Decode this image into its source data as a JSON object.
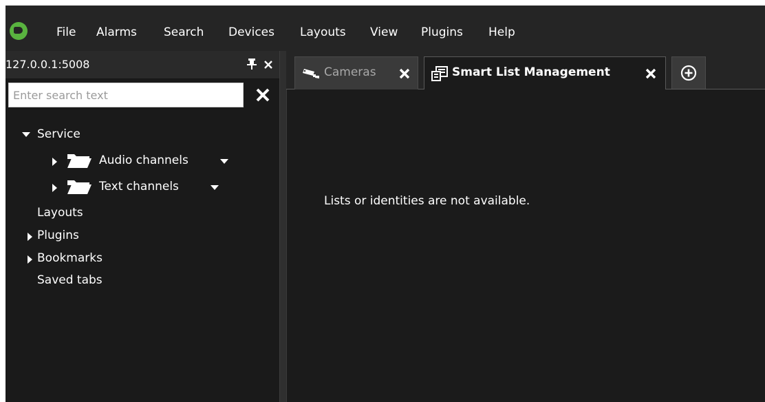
{
  "menubar": {
    "logo_icon": "camera-logo-icon",
    "items": [
      "File",
      "Alarms",
      "Search",
      "Devices",
      "Layouts",
      "View",
      "Plugins",
      "Help"
    ]
  },
  "panel": {
    "server": "127.0.0.1:5008",
    "search_placeholder": "Enter search text",
    "search_value": "",
    "tree": {
      "service": "Service",
      "audio_channels": "Audio channels",
      "text_channels": "Text channels",
      "layouts": "Layouts",
      "plugins": "Plugins",
      "bookmarks": "Bookmarks",
      "saved_tabs": "Saved tabs"
    }
  },
  "tabs": {
    "cameras": "Cameras",
    "smart_list": "Smart List Management",
    "add_icon": "plus-circle-icon"
  },
  "content": {
    "message": "Lists or identities are not available."
  },
  "colors": {
    "background": "#252525",
    "panel": "#1a1a1a",
    "logo_green": "#59b33f"
  }
}
